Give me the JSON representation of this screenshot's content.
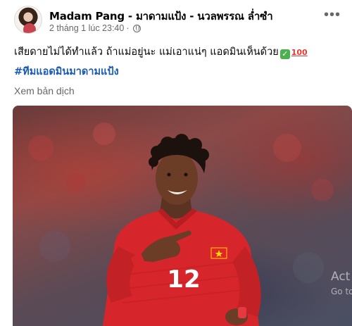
{
  "post": {
    "author": "Madam Pang - มาดามแป้ง - นวลพรรณ ล่ำซำ",
    "timestamp": "2 tháng 1 lúc 23:40",
    "separator": "·",
    "privacy_icon": "globe-icon",
    "more_icon": "more-options-icon",
    "more_label": "•••",
    "text": "เสียดายไม่ได้ทำแล้ว ถ้าแม่อยู่นะ แม่เอาแน่ๆ แอดมินเห็นด้วย",
    "check_emoji": "✓",
    "hundred_emoji": "100",
    "hashtag": "#ทีมแอดมินมาดามแป้ง",
    "translate_label": "Xem bản dịch"
  },
  "photo": {
    "jersey_number": "12",
    "watermark_line1": "Act",
    "watermark_line2": "Go to"
  },
  "colors": {
    "jersey": "#d7262b",
    "hashtag": "#1a5bb5",
    "meta": "#65676b"
  }
}
